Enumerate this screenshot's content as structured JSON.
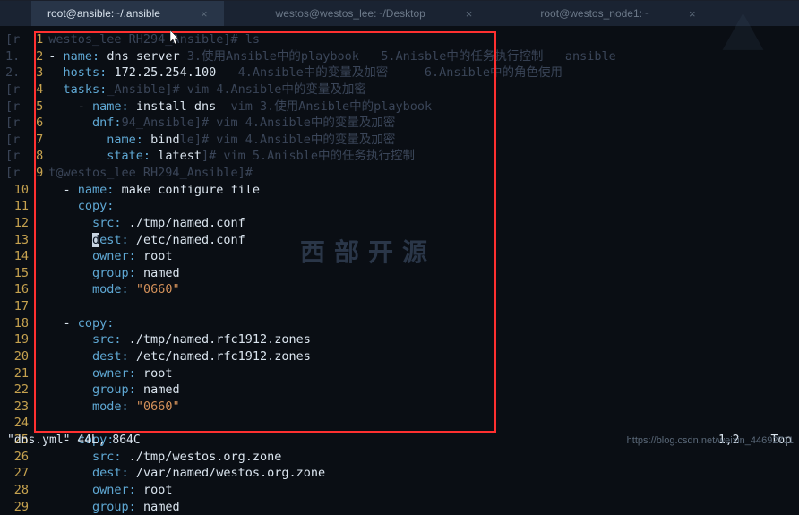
{
  "tabs": [
    {
      "title": "root@ansible:~/.ansible",
      "active": true
    },
    {
      "title": "westos@westos_lee:~/Desktop",
      "active": false
    },
    {
      "title": "root@westos_node1:~",
      "active": false
    }
  ],
  "ghost_prompt": "westos_lee RH294_Ansible]# ",
  "ghost_cmds": {
    "ls": "ls",
    "vim4": "vim 4.Ansible中的变量及加密",
    "vim3": "vim 3.使用Ansible中的playbook",
    "vim5": "vim 5.Anisble中的任务执行控制",
    "files": "3.使用Ansible中的playbook   5.Anisble中的任务执行控制   ansible",
    "files2": "4.Ansible中的变量及加密     6.Ansible中的角色使用"
  },
  "code": {
    "play_name": "dns server",
    "hosts": "172.25.254.100",
    "tasks_label": "tasks:",
    "install_name": "install dns",
    "dnf": "dnf:",
    "bind_name": "bind",
    "state": "latest",
    "make_conf": "make configure file",
    "copy": "copy:",
    "src1": "./tmp/named.conf",
    "dest1": "/etc/named.conf",
    "owner": "root",
    "group": "named",
    "mode": "\"0660\"",
    "src2": "./tmp/named.rfc1912.zones",
    "dest2": "/etc/named.rfc1912.zones",
    "src3": "./tmp/westos.org.zone",
    "dest3": "/var/named/westos.org.zone"
  },
  "status": {
    "left": "\"dns.yml\" 44L, 864C",
    "mid": "1,2",
    "right": "Top"
  },
  "watermark": "https://blog.csdn.net/weixin_44692711",
  "logo_text": "西部开源"
}
